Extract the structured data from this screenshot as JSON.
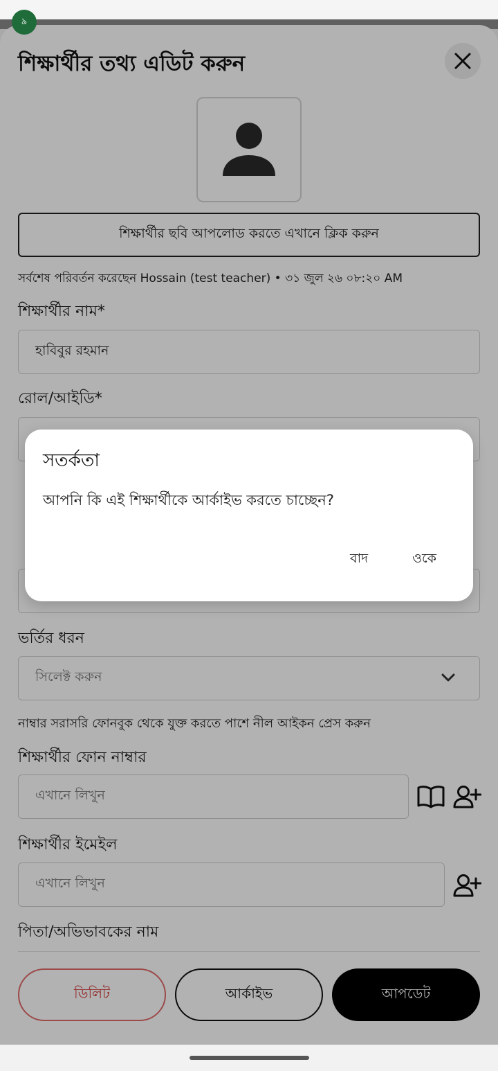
{
  "status": {
    "badge": "৯"
  },
  "sheet": {
    "title": "শিক্ষার্থীর তথ্য এডিট করুন",
    "upload_label": "শিক্ষার্থীর ছবি আপলোড করতে এখানে ক্লিক করুন",
    "last_modified": "সর্বশেষ পরিবর্তন করেছেন Hossain (test teacher) • ৩১ জুল ২৬ ০৮:২০ AM"
  },
  "form": {
    "name_label": "শিক্ষার্থীর নাম*",
    "name_value": "হাবিবুর রহমান",
    "roll_label": "রোল/আইডি*",
    "admission_label": "ভর্তির ধরন",
    "admission_value": "সিলেক্ট করুন",
    "phone_hint": "নাম্বার সরাসরি ফোনবুক থেকে যুক্ত করতে পাশে নীল আইকন প্রেস করুন",
    "phone_label": "শিক্ষার্থীর ফোন নাম্বার",
    "phone_placeholder": "এখানে লিখুন",
    "email_label": "শিক্ষার্থীর ইমেইল",
    "email_placeholder": "এখানে লিখুন",
    "guardian_label": "পিতা/অভিভাবকের নাম"
  },
  "footer": {
    "delete_label": "ডিলিট",
    "archive_label": "আর্কাইভ",
    "update_label": "আপডেট"
  },
  "dialog": {
    "title": "সতর্কতা",
    "message": "আপনি কি এই শিক্ষার্থীকে আর্কাইভ করতে চাচ্ছেন?",
    "cancel_label": "বাদ",
    "ok_label": "ওকে"
  }
}
